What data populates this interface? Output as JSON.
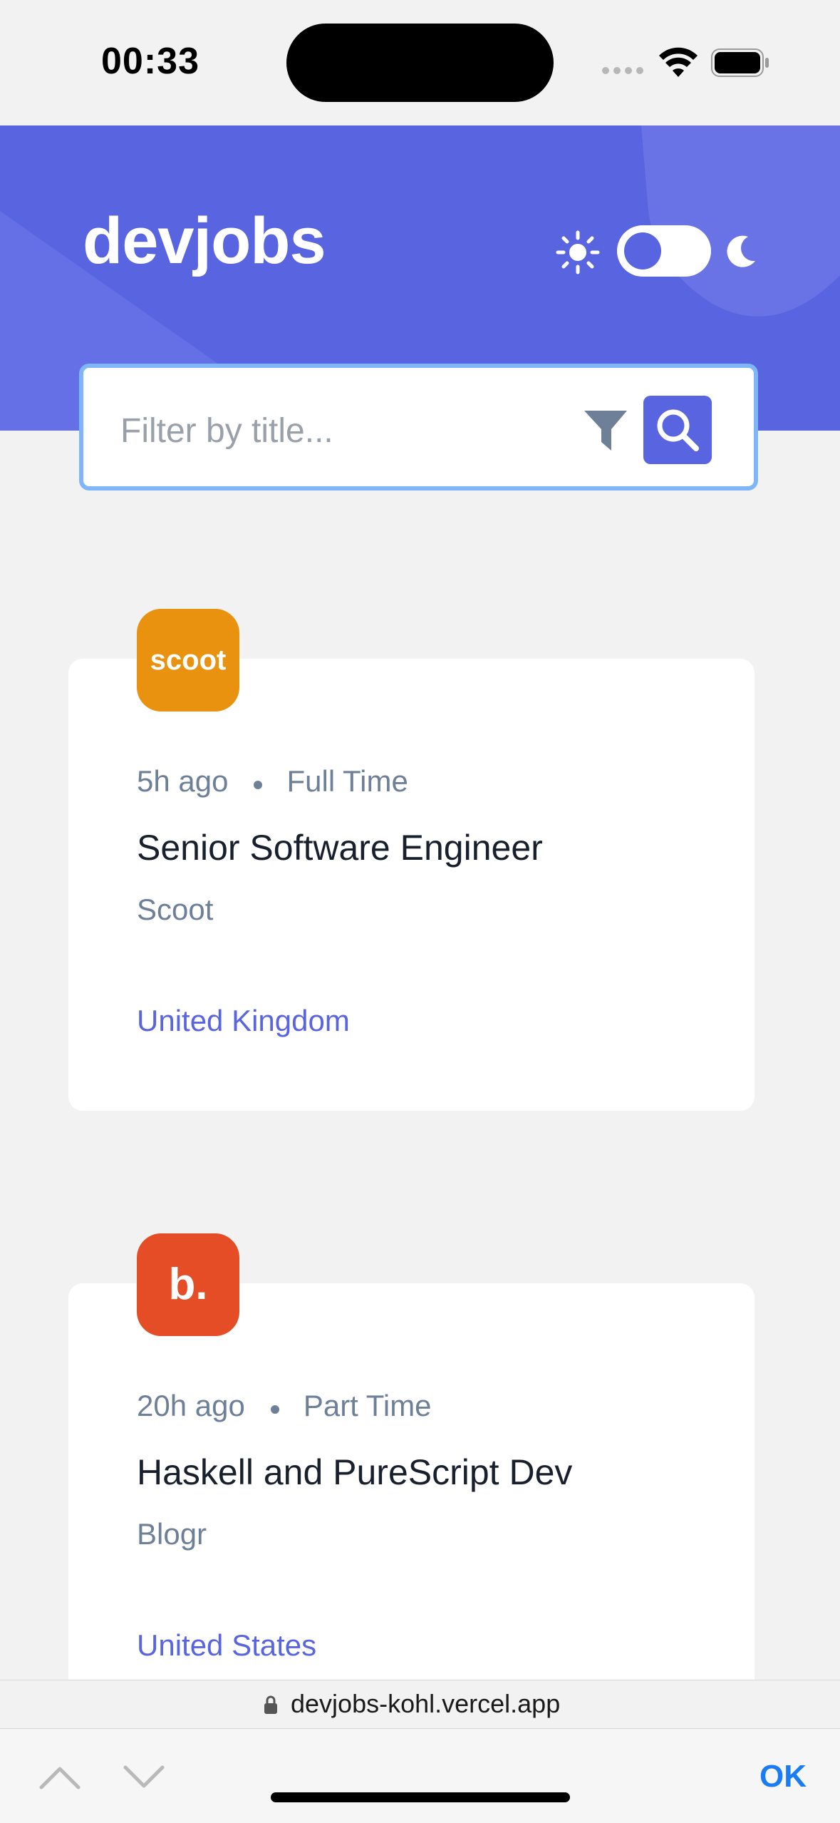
{
  "status_bar": {
    "time": "00:33"
  },
  "header": {
    "logo": "devjobs"
  },
  "search": {
    "placeholder": "Filter by title..."
  },
  "jobs": [
    {
      "logo_text": "scoot",
      "logo_color": "#e99210",
      "posted": "5h ago",
      "contract": "Full Time",
      "title": "Senior Software Engineer",
      "company": "Scoot",
      "location": "United Kingdom"
    },
    {
      "logo_text": "b.",
      "logo_color": "#e54d26",
      "posted": "20h ago",
      "contract": "Part Time",
      "title": "Haskell and PureScript Dev",
      "company": "Blogr",
      "location": "United States"
    }
  ],
  "browser": {
    "url": "devjobs-kohl.vercel.app",
    "ok_label": "OK"
  },
  "colors": {
    "accent": "#5964e0",
    "muted": "#6e8098",
    "page_bg": "#f2f2f2",
    "ios_blue": "#1a7cf5"
  },
  "icons": [
    "sun-icon",
    "moon-icon",
    "filter-icon",
    "search-icon",
    "lock-icon",
    "chevron-up-icon",
    "chevron-down-icon",
    "wifi-icon",
    "battery-icon"
  ]
}
